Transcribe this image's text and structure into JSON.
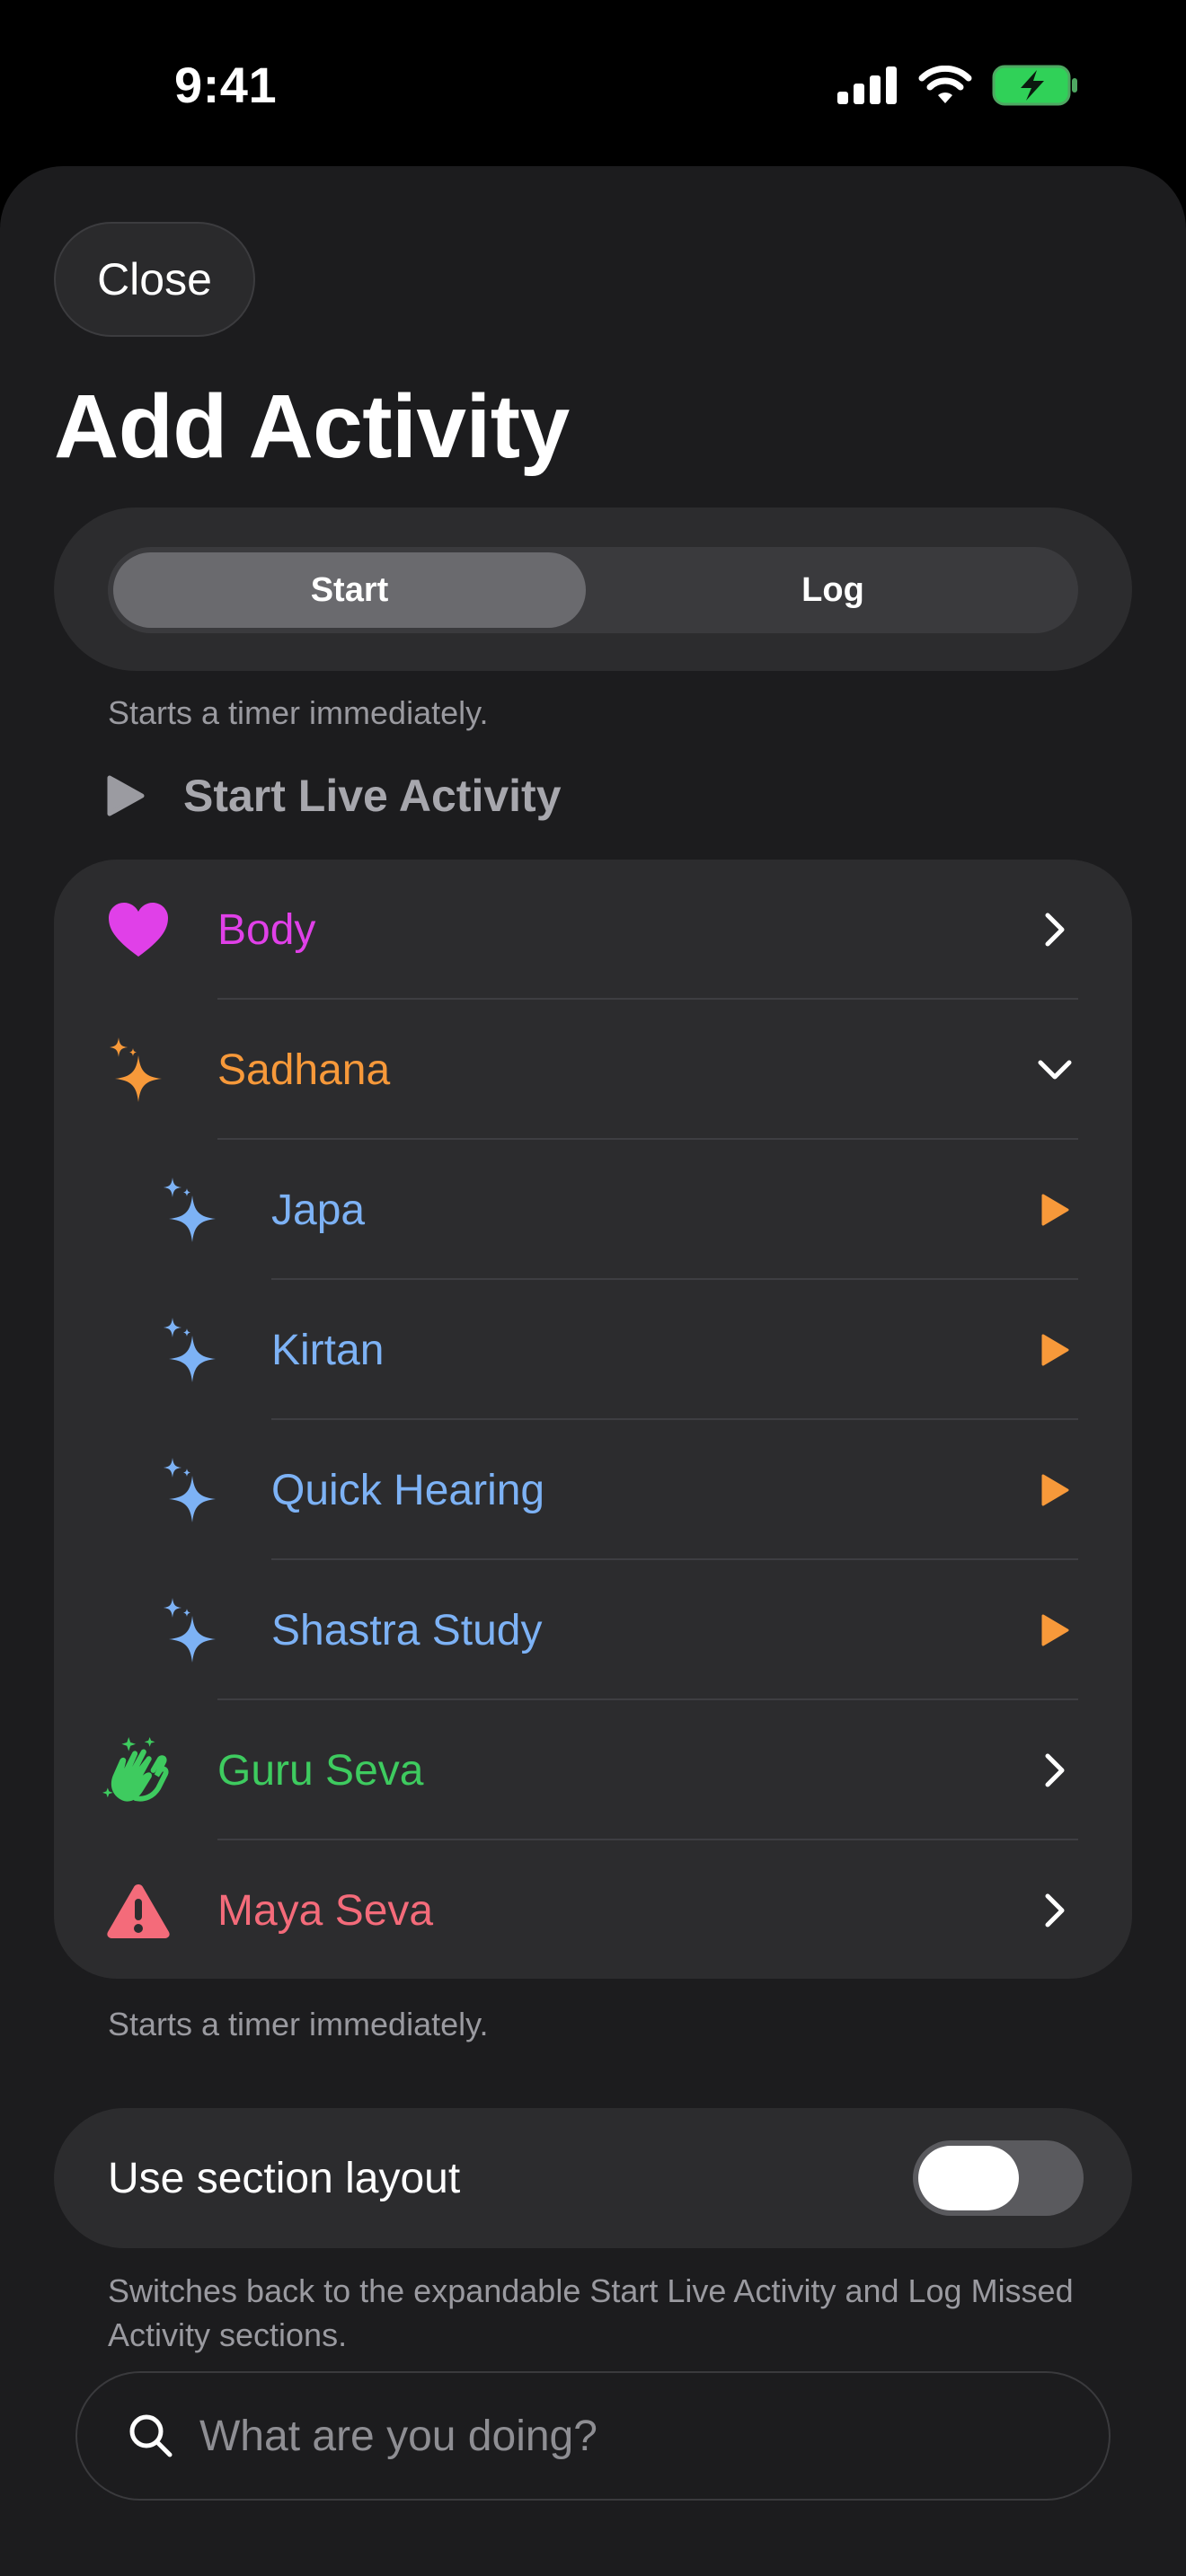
{
  "status_bar": {
    "time": "9:41",
    "icons": [
      "cellular-icon",
      "wifi-icon",
      "battery-charging-icon"
    ]
  },
  "header": {
    "close_label": "Close",
    "title": "Add Activity"
  },
  "mode_picker": {
    "options": [
      "Start",
      "Log"
    ],
    "selected": "Start"
  },
  "start_hint": "Starts a timer immediately.",
  "live_activity": {
    "label": "Start Live Activity",
    "icon": "play-icon"
  },
  "activities": [
    {
      "label": "Body",
      "color": "#e040e8",
      "icon": "heart-icon",
      "trailing": "chevron-right",
      "level": 0
    },
    {
      "label": "Sadhana",
      "color": "#f7993a",
      "icon": "sparkles-icon",
      "trailing": "chevron-down",
      "level": 0
    },
    {
      "label": "Japa",
      "color": "#7db2f5",
      "icon": "sparkles-icon",
      "trailing": "play",
      "level": 1
    },
    {
      "label": "Kirtan",
      "color": "#7db2f5",
      "icon": "sparkles-icon",
      "trailing": "play",
      "level": 1
    },
    {
      "label": "Quick Hearing",
      "color": "#7db2f5",
      "icon": "sparkles-icon",
      "trailing": "play",
      "level": 1
    },
    {
      "label": "Shastra Study",
      "color": "#7db2f5",
      "icon": "sparkles-icon",
      "trailing": "play",
      "level": 1
    },
    {
      "label": "Guru Seva",
      "color": "#3ecb5f",
      "icon": "clapping-hands-icon",
      "trailing": "chevron-right",
      "level": 0
    },
    {
      "label": "Maya Seva",
      "color": "#f46b7a",
      "icon": "warning-icon",
      "trailing": "chevron-right",
      "level": 0
    }
  ],
  "list_footer_hint": "Starts a timer immediately.",
  "section_layout": {
    "label": "Use section layout",
    "enabled": false
  },
  "section_layout_hint": "Switches back to the expandable Start Live Activity and Log Missed Activity sections.",
  "search": {
    "placeholder": "What are you doing?",
    "value": ""
  },
  "colors": {
    "accent_play": "#f7993a",
    "sheet_bg": "#1c1c1e",
    "card_bg": "#2c2c2e"
  }
}
